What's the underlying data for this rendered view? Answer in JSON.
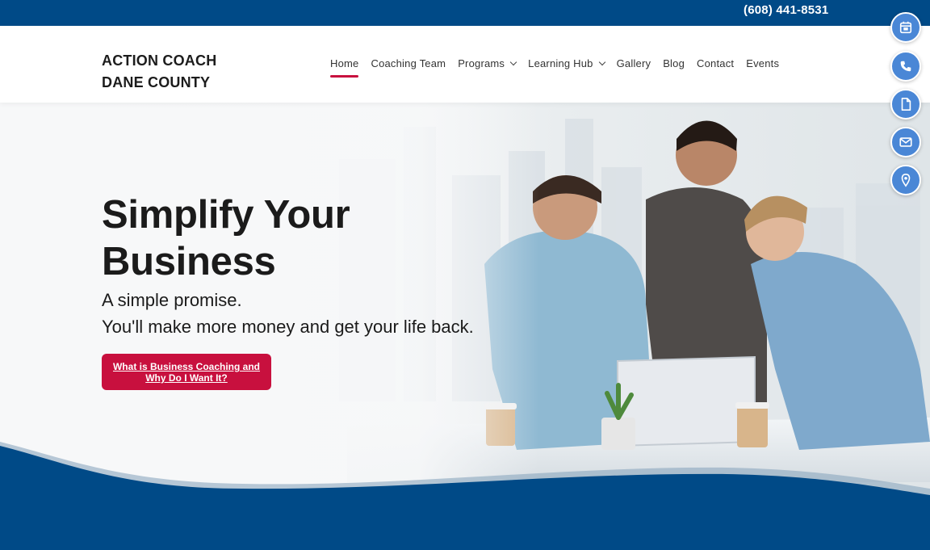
{
  "topbar": {
    "phone": "(608) 441-8531"
  },
  "header": {
    "logo_line1": "ACTION COACH",
    "logo_line2": "DANE COUNTY",
    "nav": [
      {
        "label": "Home",
        "active": true
      },
      {
        "label": "Coaching Team"
      },
      {
        "label": "Programs",
        "dropdown": true
      },
      {
        "label": "Learning Hub",
        "dropdown": true
      },
      {
        "label": "Gallery"
      },
      {
        "label": "Blog"
      },
      {
        "label": "Contact"
      },
      {
        "label": "Events"
      }
    ]
  },
  "hero": {
    "title_line1": "Simplify Your",
    "title_line2": "Business",
    "subtitle_line1": "A simple promise.",
    "subtitle_line2": "You'll make more money and get your life back.",
    "cta_line1": "What is Business Coaching and",
    "cta_line2": "Why Do I Want It?"
  },
  "side_buttons": [
    "calendar-icon",
    "phone-icon",
    "document-icon",
    "mail-icon",
    "location-pin-icon"
  ],
  "colors": {
    "brand_blue": "#004a87",
    "accent_red": "#c8103e",
    "fab_blue": "#4a87d6"
  }
}
